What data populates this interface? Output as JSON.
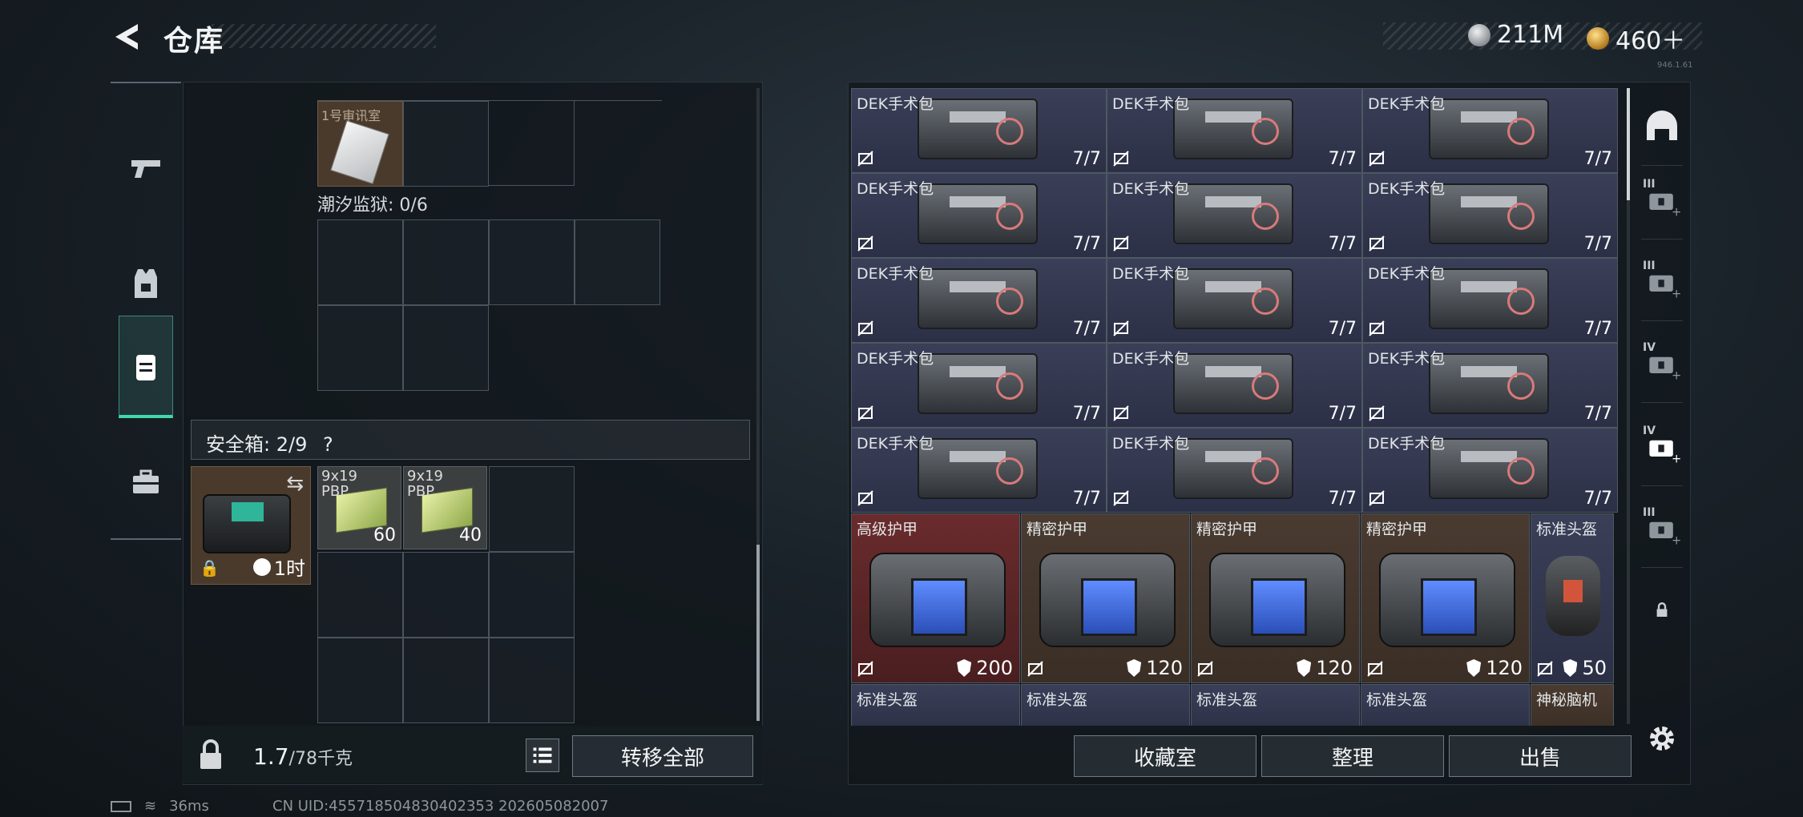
{
  "header": {
    "title": "仓库",
    "currency_silver": "211M",
    "currency_gold": "460＋",
    "version": "946.1.61"
  },
  "left_tabs": [
    {
      "name": "weapons",
      "icon": "pistol-icon"
    },
    {
      "name": "armor",
      "icon": "vest-icon"
    },
    {
      "name": "backpack",
      "icon": "backpack-icon",
      "active": true
    },
    {
      "name": "case",
      "icon": "briefcase-icon"
    }
  ],
  "left_panel": {
    "keycard_label": "1号审讯室",
    "prison_label": "潮汐监狱: 0/6",
    "safe_label": "安全箱: 2/9",
    "safe_help": "?",
    "safe_timer": "1时",
    "ammo": [
      {
        "name": "9x19",
        "sub": "PBP",
        "count": "60"
      },
      {
        "name": "9x19",
        "sub": "PBP",
        "count": "40"
      }
    ],
    "weight_value": "1.7",
    "weight_max": "/78千克",
    "transfer_all": "转移全部"
  },
  "stash": {
    "kits": [
      {
        "name": "DEK手术包",
        "count": "7/7"
      },
      {
        "name": "DEK手术包",
        "count": "7/7"
      },
      {
        "name": "DEK手术包",
        "count": "7/7"
      },
      {
        "name": "DEK手术包",
        "count": "7/7"
      },
      {
        "name": "DEK手术包",
        "count": "7/7"
      },
      {
        "name": "DEK手术包",
        "count": "7/7"
      },
      {
        "name": "DEK手术包",
        "count": "7/7"
      },
      {
        "name": "DEK手术包",
        "count": "7/7"
      },
      {
        "name": "DEK手术包",
        "count": "7/7"
      },
      {
        "name": "DEK手术包",
        "count": "7/7"
      },
      {
        "name": "DEK手术包",
        "count": "7/7"
      },
      {
        "name": "DEK手术包",
        "count": "7/7"
      },
      {
        "name": "DEK手术包",
        "count": "7/7"
      },
      {
        "name": "DEK手术包",
        "count": "7/7"
      },
      {
        "name": "DEK手术包",
        "count": "7/7"
      }
    ],
    "armors": [
      {
        "name": "高级护甲",
        "value": "200"
      },
      {
        "name": "精密护甲",
        "value": "120"
      },
      {
        "name": "精密护甲",
        "value": "120"
      },
      {
        "name": "精密护甲",
        "value": "120"
      }
    ],
    "helmet": {
      "name": "标准头盔",
      "value": "50"
    },
    "bottom_row": [
      "标准头盔",
      "标准头盔",
      "标准头盔",
      "标准头盔",
      "神秘脑机"
    ],
    "buttons": {
      "collection": "收藏室",
      "sort": "整理",
      "sell": "出售"
    }
  },
  "filters": [
    {
      "tier": "",
      "icon": "helmet-filter-icon"
    },
    {
      "tier": "III",
      "icon": "rig-filter-icon"
    },
    {
      "tier": "III",
      "icon": "armor-filter-icon"
    },
    {
      "tier": "IV",
      "icon": "medkit-add-filter-icon"
    },
    {
      "tier": "IV",
      "icon": "medkit-add-filter-icon-active"
    },
    {
      "tier": "III",
      "icon": "armor-filter-icon-2"
    },
    {
      "tier": "",
      "icon": "lock-filter-icon"
    }
  ],
  "status": {
    "ping": "36ms",
    "uid": "CN UID:455718504830402353 202605082007"
  }
}
